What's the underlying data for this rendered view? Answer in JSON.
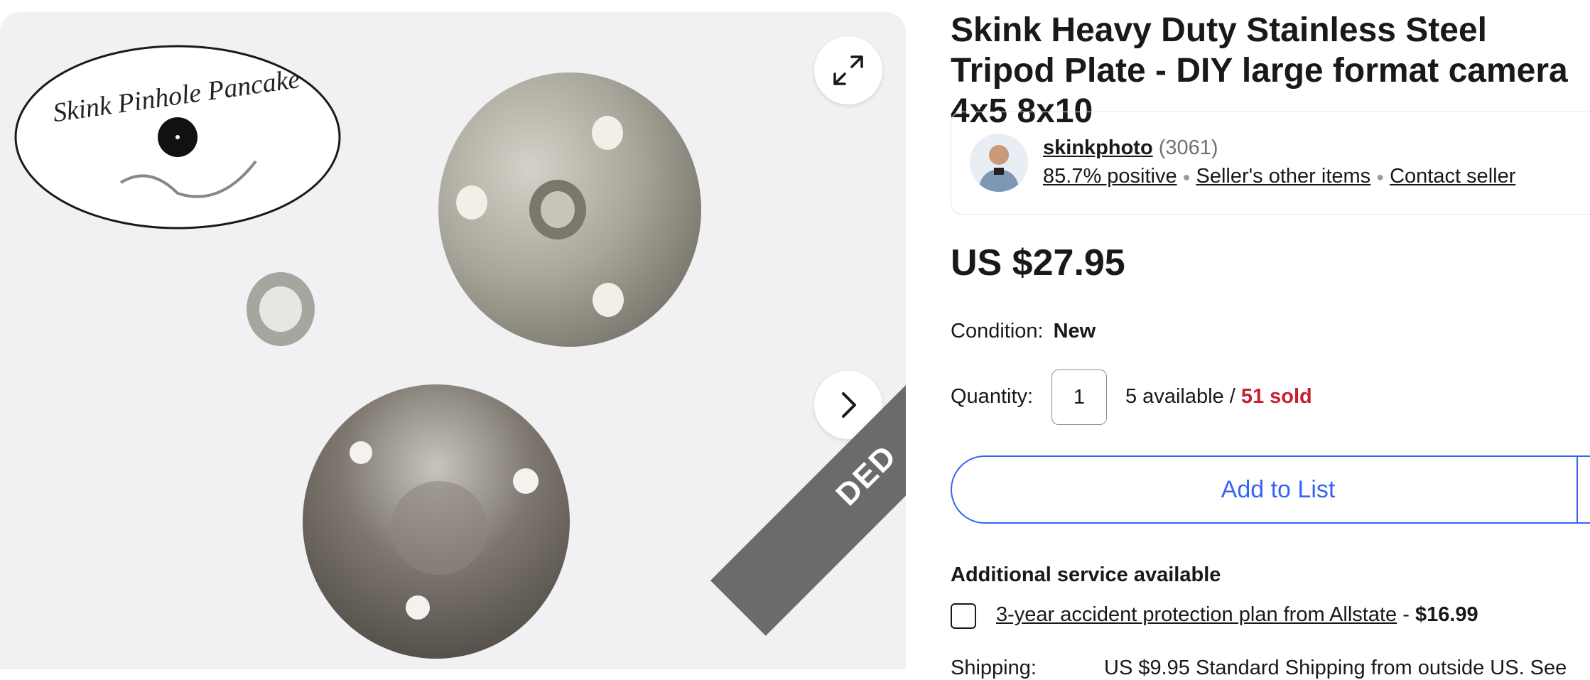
{
  "gallery": {
    "logo_text": "Skink Pinhole Pancake",
    "ribbon_text": "DED",
    "expand_icon": "expand-arrows-icon",
    "next_icon": "chevron-right-icon"
  },
  "listing": {
    "title": "Skink Heavy Duty Stainless Steel Tripod Plate - DIY large format camera 4x5 8x10"
  },
  "seller": {
    "name": "skinkphoto",
    "feedback_count": "(3061)",
    "positive": "85.7% positive",
    "other_items": "Seller's other items",
    "contact": "Contact seller"
  },
  "price": "US $27.95",
  "condition": {
    "label": "Condition:",
    "value": "New"
  },
  "quantity": {
    "label": "Quantity:",
    "value": "1",
    "available": "5 available / ",
    "sold": "51 sold"
  },
  "actions": {
    "add_to_list": "Add to List"
  },
  "additional_service": {
    "title": "Additional service available",
    "plan_link": "3-year accident protection plan from Allstate",
    "separator": " - ",
    "plan_price": "$16.99"
  },
  "shipping": {
    "label": "Shipping:",
    "value": "US $9.95 Standard Shipping from outside US. See"
  },
  "colors": {
    "accent": "#3665f3",
    "sold": "#c62132",
    "text": "#191919"
  }
}
